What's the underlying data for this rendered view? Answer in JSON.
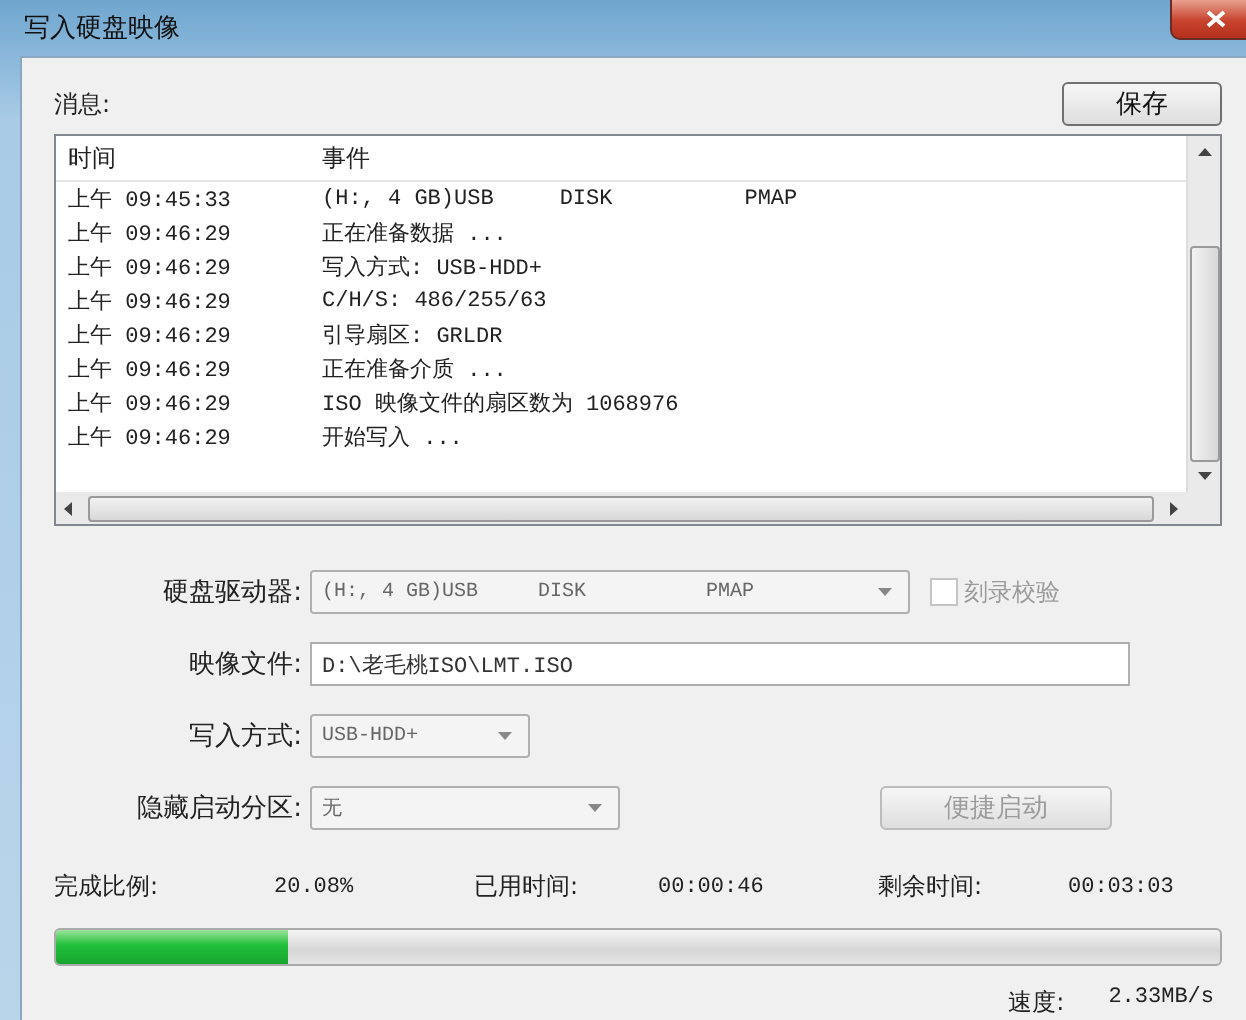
{
  "window": {
    "title": "写入硬盘映像"
  },
  "messages": {
    "label": "消息:",
    "save_button": "保存",
    "columns": [
      "时间",
      "事件"
    ],
    "rows": [
      {
        "time": "上午 09:45:33",
        "event": "(H:, 4 GB)USB     DISK          PMAP"
      },
      {
        "time": "上午 09:46:29",
        "event": "正在准备数据 ..."
      },
      {
        "time": "上午 09:46:29",
        "event": "写入方式: USB-HDD+"
      },
      {
        "time": "上午 09:46:29",
        "event": "C/H/S: 486/255/63"
      },
      {
        "time": "上午 09:46:29",
        "event": "引导扇区: GRLDR"
      },
      {
        "time": "上午 09:46:29",
        "event": "正在准备介质 ..."
      },
      {
        "time": "上午 09:46:29",
        "event": "ISO 映像文件的扇区数为 1068976"
      },
      {
        "time": "上午 09:46:29",
        "event": "开始写入 ..."
      }
    ]
  },
  "form": {
    "drive": {
      "label": "硬盘驱动器:",
      "value": "(H:, 4 GB)USB     DISK          PMAP",
      "disabled": true
    },
    "verify": {
      "label": "刻录校验",
      "checked": false,
      "disabled": true
    },
    "image_file": {
      "label": "映像文件:",
      "value": "D:\\老毛桃ISO\\LMT.ISO",
      "disabled": false
    },
    "write_mode": {
      "label": "写入方式:",
      "value": "USB-HDD+",
      "disabled": true
    },
    "hidden_partition": {
      "label": "隐藏启动分区:",
      "value": "无",
      "disabled": true
    },
    "quick_boot_button": {
      "label": "便捷启动",
      "disabled": true
    }
  },
  "progress": {
    "percent_label": "完成比例:",
    "percent": "20.08%",
    "elapsed_label": "已用时间:",
    "elapsed": "00:00:46",
    "remaining_label": "剩余时间:",
    "remaining": "00:03:03",
    "level": 0.2,
    "speed_label": "速度:",
    "speed": "2.33MB/s"
  }
}
